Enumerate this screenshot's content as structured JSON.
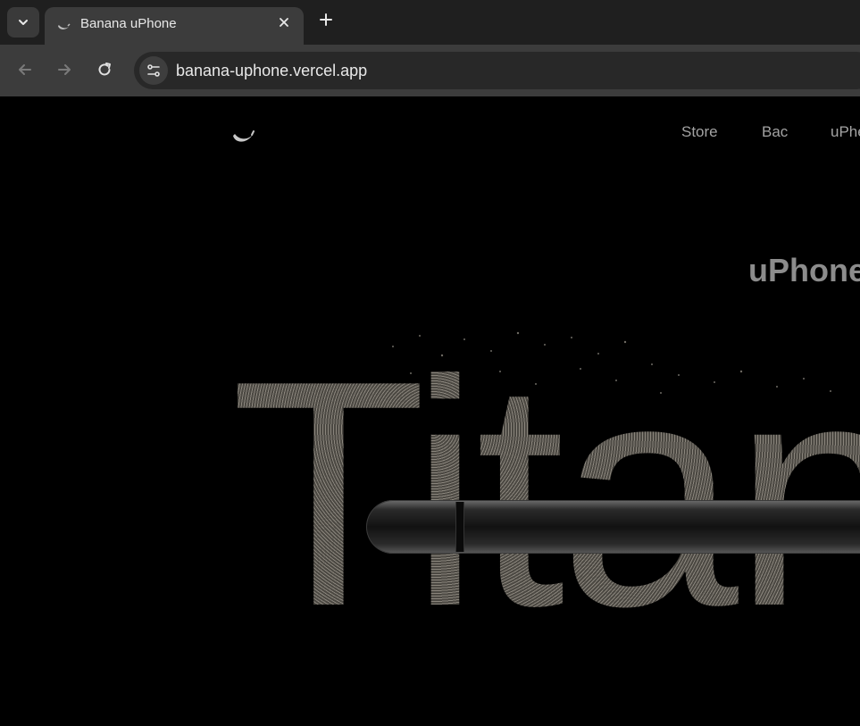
{
  "browser": {
    "tab": {
      "title": "Banana uPhone",
      "close_icon": "close-icon"
    },
    "new_tab_label": "+",
    "url": "banana-uphone.vercel.app"
  },
  "site": {
    "nav": [
      {
        "label": "Store"
      },
      {
        "label": "Bac"
      },
      {
        "label": "uPhe"
      }
    ],
    "hero": {
      "subtitle": "uPhone",
      "word": "Titan"
    }
  },
  "colors": {
    "chrome_bg": "#1f1f1f",
    "toolbar_bg": "#3c3c3c",
    "page_bg": "#000000",
    "nav_text": "#a3a3a3",
    "titanium": "#6e6a62"
  }
}
